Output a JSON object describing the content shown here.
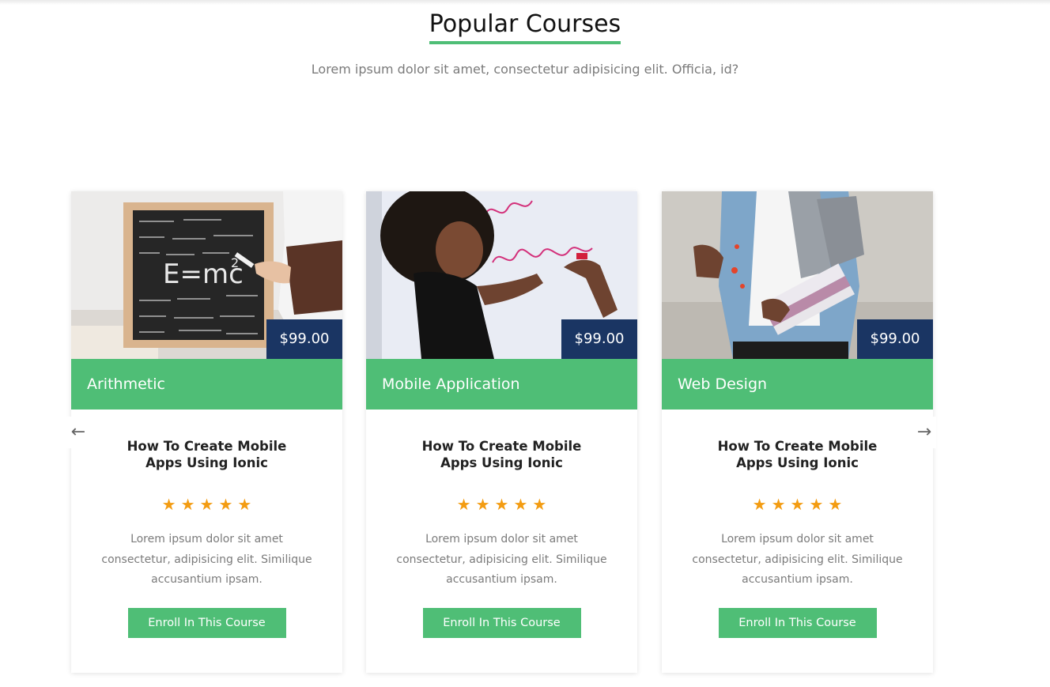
{
  "section": {
    "title": "Popular Courses",
    "subtitle": "Lorem ipsum dolor sit amet, consectetur adipisicing elit. Officia, id?"
  },
  "carousel": {
    "prev_icon": "←",
    "next_icon": "→"
  },
  "colors": {
    "accent_green": "#4fbe76",
    "price_navy": "#1a3563",
    "star_orange": "#f39c12"
  },
  "courses": [
    {
      "price": "$99.00",
      "category": "Arithmetic",
      "title": "How To Create Mobile Apps Using Ionic",
      "rating": 5,
      "stars": [
        "★",
        "★",
        "★",
        "★",
        "★"
      ],
      "description": "Lorem ipsum dolor sit amet consectetur, adipisicing elit. Similique accusantium ipsam.",
      "button": "Enroll In This Course"
    },
    {
      "price": "$99.00",
      "category": "Mobile Application",
      "title": "How To Create Mobile Apps Using Ionic",
      "rating": 5,
      "stars": [
        "★",
        "★",
        "★",
        "★",
        "★"
      ],
      "description": "Lorem ipsum dolor sit amet consectetur, adipisicing elit. Similique accusantium ipsam.",
      "button": "Enroll In This Course"
    },
    {
      "price": "$99.00",
      "category": "Web Design",
      "title": "How To Create Mobile Apps Using Ionic",
      "rating": 5,
      "stars": [
        "★",
        "★",
        "★",
        "★",
        "★"
      ],
      "description": "Lorem ipsum dolor sit amet consectetur, adipisicing elit. Similique accusantium ipsam.",
      "button": "Enroll In This Course"
    }
  ]
}
